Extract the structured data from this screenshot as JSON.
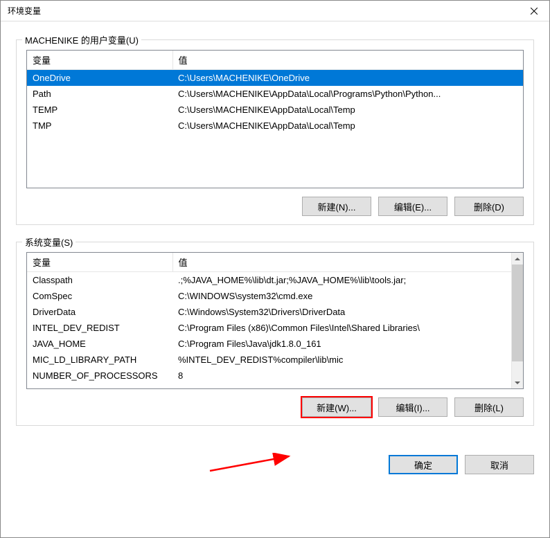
{
  "dialog": {
    "title": "环境变量"
  },
  "userVars": {
    "groupLabel": "MACHENIKE 的用户变量(U)",
    "columns": {
      "var": "变量",
      "value": "值"
    },
    "rows": [
      {
        "var": "OneDrive",
        "value": "C:\\Users\\MACHENIKE\\OneDrive"
      },
      {
        "var": "Path",
        "value": "C:\\Users\\MACHENIKE\\AppData\\Local\\Programs\\Python\\Python..."
      },
      {
        "var": "TEMP",
        "value": "C:\\Users\\MACHENIKE\\AppData\\Local\\Temp"
      },
      {
        "var": "TMP",
        "value": "C:\\Users\\MACHENIKE\\AppData\\Local\\Temp"
      }
    ],
    "buttons": {
      "new": "新建(N)...",
      "edit": "编辑(E)...",
      "delete": "删除(D)"
    }
  },
  "systemVars": {
    "groupLabel": "系统变量(S)",
    "columns": {
      "var": "变量",
      "value": "值"
    },
    "rows": [
      {
        "var": "Classpath",
        "value": ".;%JAVA_HOME%\\lib\\dt.jar;%JAVA_HOME%\\lib\\tools.jar;"
      },
      {
        "var": "ComSpec",
        "value": "C:\\WINDOWS\\system32\\cmd.exe"
      },
      {
        "var": "DriverData",
        "value": "C:\\Windows\\System32\\Drivers\\DriverData"
      },
      {
        "var": "INTEL_DEV_REDIST",
        "value": "C:\\Program Files (x86)\\Common Files\\Intel\\Shared Libraries\\"
      },
      {
        "var": "JAVA_HOME",
        "value": "C:\\Program Files\\Java\\jdk1.8.0_161"
      },
      {
        "var": "MIC_LD_LIBRARY_PATH",
        "value": "%INTEL_DEV_REDIST%compiler\\lib\\mic"
      },
      {
        "var": "NUMBER_OF_PROCESSORS",
        "value": "8"
      }
    ],
    "partialRow": {
      "var": "",
      "value": ""
    },
    "buttons": {
      "new": "新建(W)...",
      "edit": "编辑(I)...",
      "delete": "删除(L)"
    }
  },
  "dialogButtons": {
    "ok": "确定",
    "cancel": "取消"
  }
}
